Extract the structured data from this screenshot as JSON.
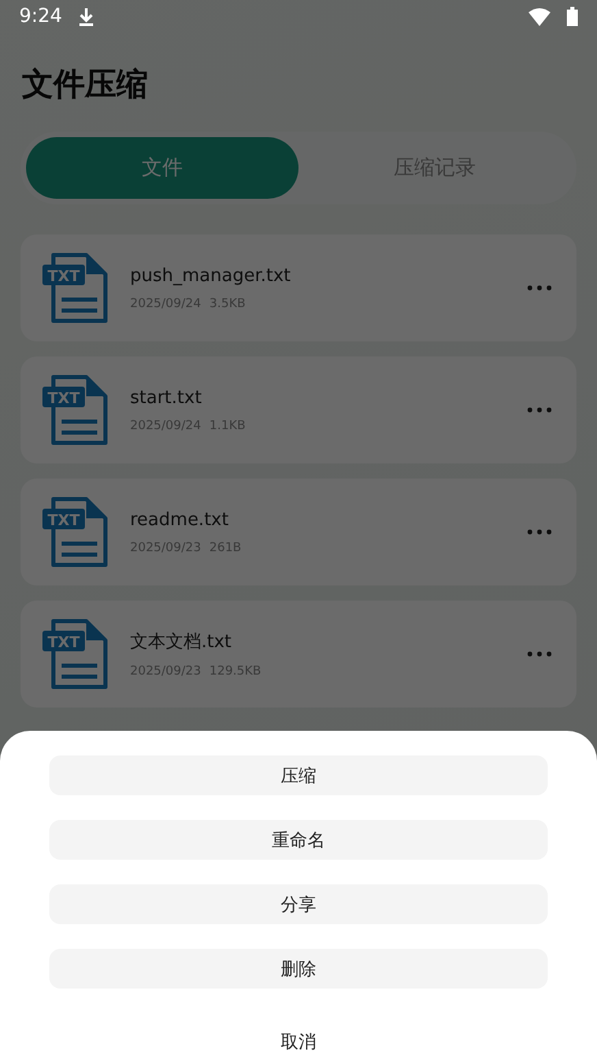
{
  "status_bar": {
    "time": "9:24"
  },
  "title": "文件压缩",
  "tabs": [
    {
      "label": "文件",
      "selected": true
    },
    {
      "label": "压缩记录",
      "selected": false
    }
  ],
  "files": [
    {
      "name": "push_manager.txt",
      "date": "2025/09/24",
      "size": "3.5KB",
      "type": "TXT"
    },
    {
      "name": "start.txt",
      "date": "2025/09/24",
      "size": "1.1KB",
      "type": "TXT"
    },
    {
      "name": "readme.txt",
      "date": "2025/09/23",
      "size": "261B",
      "type": "TXT"
    },
    {
      "name": "文本文档.txt",
      "date": "2025/09/23",
      "size": "129.5KB",
      "type": "TXT"
    }
  ],
  "action_sheet": {
    "actions": [
      "压缩",
      "重命名",
      "分享",
      "删除"
    ],
    "cancel": "取消"
  }
}
